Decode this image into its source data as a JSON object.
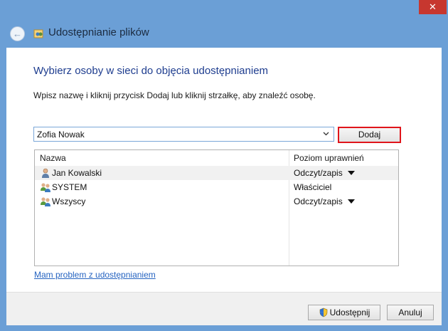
{
  "window": {
    "title": "Udostępnianie plików",
    "close_label": "✕"
  },
  "main": {
    "heading": "Wybierz osoby w sieci do objęcia udostępnianiem",
    "instruction": "Wpisz nazwę i kliknij przycisk Dodaj lub kliknij strzałkę, aby znaleźć osobę.",
    "combo_value": "Zofia Nowak",
    "add_label": "Dodaj"
  },
  "list": {
    "headers": [
      "Nazwa",
      "Poziom uprawnień"
    ],
    "rows": [
      {
        "name": "Jan Kowalski",
        "permission": "Odczyt/zapis",
        "icon": "user-icon",
        "selected": true,
        "has_dropdown": true
      },
      {
        "name": "SYSTEM",
        "permission": "Właściciel",
        "icon": "users-group-icon",
        "selected": false,
        "has_dropdown": false
      },
      {
        "name": "Wszyscy",
        "permission": "Odczyt/zapis",
        "icon": "users-group-icon",
        "selected": false,
        "has_dropdown": true
      }
    ]
  },
  "help_link": "Mam problem z udostępnianiem",
  "footer": {
    "share_label": "Udostępnij",
    "cancel_label": "Anuluj"
  },
  "colors": {
    "frame": "#6b9fd6",
    "heading": "#1e3d8f",
    "link": "#2664c1",
    "close": "#c7372f",
    "highlight_border": "#e0151b"
  }
}
